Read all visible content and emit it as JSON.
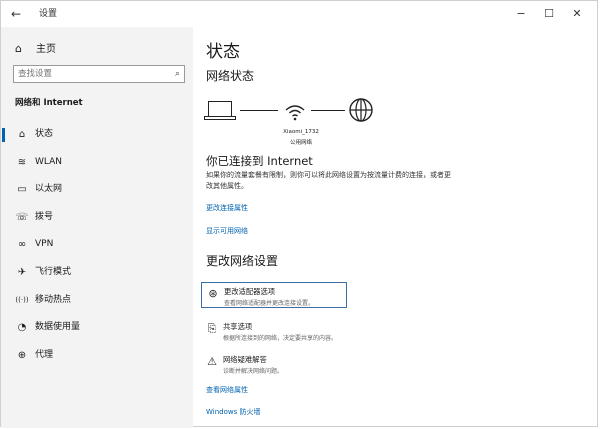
{
  "titlebar": {
    "back_glyph": "←",
    "title": "设置",
    "minimize_glyph": "−",
    "maximize_glyph": "☐",
    "close_glyph": "✕"
  },
  "sidebar": {
    "home_label": "主页",
    "search_placeholder": "查找设置",
    "section_label": "网络和 Internet",
    "items": [
      {
        "label": "状态",
        "icon": "status-icon",
        "glyph": "⌂"
      },
      {
        "label": "WLAN",
        "icon": "wifi-icon",
        "glyph": "≋"
      },
      {
        "label": "以太网",
        "icon": "ethernet-icon",
        "glyph": "▭"
      },
      {
        "label": "拨号",
        "icon": "dialup-icon",
        "glyph": "☏"
      },
      {
        "label": "VPN",
        "icon": "vpn-icon",
        "glyph": "∞"
      },
      {
        "label": "飞行模式",
        "icon": "airplane-icon",
        "glyph": "✈"
      },
      {
        "label": "移动热点",
        "icon": "hotspot-icon",
        "glyph": "((·))"
      },
      {
        "label": "数据使用量",
        "icon": "data-usage-icon",
        "glyph": "◔"
      },
      {
        "label": "代理",
        "icon": "proxy-icon",
        "glyph": "⊕"
      }
    ],
    "active_index": 0
  },
  "main": {
    "title": "状态",
    "network_status_heading": "网络状态",
    "network_name": "Xiaomi_1732",
    "network_type": "公用网络",
    "connected_title": "你已连接到 Internet",
    "connected_desc": "如果你的流量套餐有限制，则你可以将此网络设置为按流量计费的连接，或者更改其他属性。",
    "link_change_props": "更改连接属性",
    "link_show_networks": "显示可用网络",
    "change_settings_heading": "更改网络设置",
    "options": [
      {
        "title": "更改适配器选项",
        "desc": "查看网络适配器并更改连接设置。",
        "icon": "adapter-icon",
        "glyph": "⊛"
      },
      {
        "title": "共享选项",
        "desc": "根据所连接到的网络，决定要共享的内容。",
        "icon": "sharing-icon",
        "glyph": "⎘"
      },
      {
        "title": "网络疑难解答",
        "desc": "诊断并解决网络问题。",
        "icon": "warning-icon",
        "glyph": "⚠"
      }
    ],
    "link_view_props": "查看网络属性",
    "link_firewall": "Windows 防火墙"
  }
}
